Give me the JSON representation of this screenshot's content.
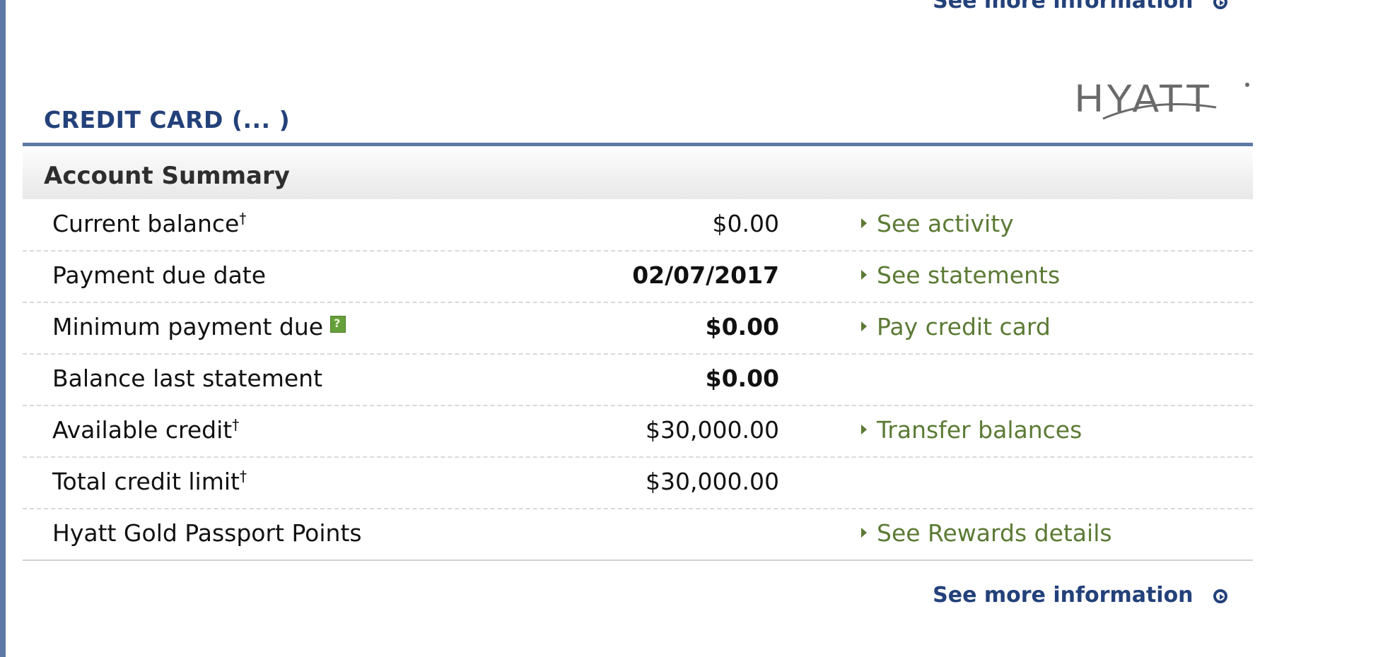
{
  "top_link": {
    "label": "See more information"
  },
  "card": {
    "title_prefix": "CREDIT CARD (...",
    "title_masked": "  ",
    "title_suffix": ")"
  },
  "logo": {
    "text": "HYATT"
  },
  "summary": {
    "heading": "Account Summary"
  },
  "rows": [
    {
      "label": "Current balance",
      "dagger": "†",
      "value": "$0.00",
      "action": "See activity"
    },
    {
      "label": "Payment due date",
      "dagger": "",
      "value": "02/07/2017",
      "action": "See statements"
    },
    {
      "label": "Minimum payment due",
      "dagger": "",
      "value": "$0.00",
      "action": "Pay credit card"
    },
    {
      "label": "Balance last statement",
      "dagger": "",
      "value": "$0.00",
      "action": ""
    },
    {
      "label": "Available credit",
      "dagger": "†",
      "value": "$30,000.00",
      "action": "Transfer balances"
    },
    {
      "label": "Total credit limit",
      "dagger": "†",
      "value": "$30,000.00",
      "action": ""
    },
    {
      "label": "Hyatt Gold Passport Points",
      "dagger": "",
      "value": "",
      "action": "See Rewards details"
    }
  ],
  "bottom_link": {
    "label": "See more information"
  },
  "colors": {
    "navy": "#23417a",
    "link_green": "#5b7a34",
    "rule_blue": "#5f79a6"
  },
  "icons": [
    "chevron-circle-right-icon",
    "triangle-right-icon",
    "help-icon"
  ]
}
